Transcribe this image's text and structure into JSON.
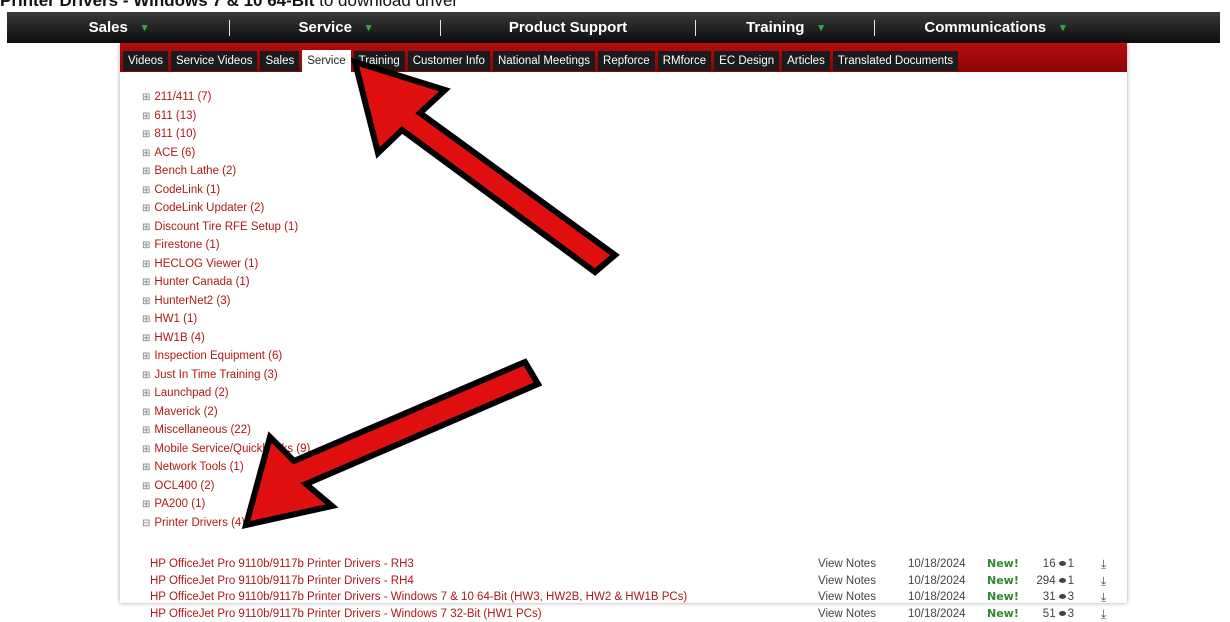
{
  "caption": {
    "prefix": "Printer Drivers - Windows 7 & 10 64-Bit",
    "suffix": " to download driver"
  },
  "navbar": {
    "items": [
      {
        "label": "Sales",
        "caret": true
      },
      {
        "label": "Service",
        "caret": true
      },
      {
        "label": "Product Support",
        "caret": false
      },
      {
        "label": "Training",
        "caret": true
      },
      {
        "label": "Communications",
        "caret": true
      }
    ]
  },
  "subnav": {
    "tabs": [
      "Videos",
      "Service Videos",
      "Sales",
      "Service",
      "Training",
      "Customer Info",
      "National Meetings",
      "Repforce",
      "RMforce",
      "EC Design",
      "Articles",
      "Translated Documents"
    ],
    "active": "Service"
  },
  "tree": [
    {
      "label": "211/411 (7)",
      "expanded": false
    },
    {
      "label": "611 (13)",
      "expanded": false
    },
    {
      "label": "811 (10)",
      "expanded": false
    },
    {
      "label": "ACE (6)",
      "expanded": false
    },
    {
      "label": "Bench Lathe (2)",
      "expanded": false
    },
    {
      "label": "CodeLink (1)",
      "expanded": false
    },
    {
      "label": "CodeLink Updater (2)",
      "expanded": false
    },
    {
      "label": "Discount Tire RFE Setup (1)",
      "expanded": false
    },
    {
      "label": "Firestone (1)",
      "expanded": false
    },
    {
      "label": "HECLOG Viewer (1)",
      "expanded": false
    },
    {
      "label": "Hunter Canada (1)",
      "expanded": false
    },
    {
      "label": "HunterNet2 (3)",
      "expanded": false
    },
    {
      "label": "HW1 (1)",
      "expanded": false
    },
    {
      "label": "HW1B (4)",
      "expanded": false
    },
    {
      "label": "Inspection Equipment (6)",
      "expanded": false
    },
    {
      "label": "Just In Time Training (3)",
      "expanded": false
    },
    {
      "label": "Launchpad (2)",
      "expanded": false
    },
    {
      "label": "Maverick (2)",
      "expanded": false
    },
    {
      "label": "Miscellaneous (22)",
      "expanded": false
    },
    {
      "label": "Mobile Service/Quickbooks (9)",
      "expanded": false
    },
    {
      "label": "Network Tools (1)",
      "expanded": false
    },
    {
      "label": "OCL400 (2)",
      "expanded": false
    },
    {
      "label": "PA200 (1)",
      "expanded": false
    },
    {
      "label": "Printer Drivers (4)",
      "expanded": true
    }
  ],
  "documents": [
    {
      "title": "HP OfficeJet Pro 9110b/9117b Printer Drivers - RH3",
      "notes": "View Notes",
      "date": "10/18/2024",
      "badge": "New!",
      "views": "16",
      "downloads": "1"
    },
    {
      "title": "HP OfficeJet Pro 9110b/9117b Printer Drivers - RH4",
      "notes": "View Notes",
      "date": "10/18/2024",
      "badge": "New!",
      "views": "294",
      "downloads": "1"
    },
    {
      "title": "HP OfficeJet Pro 9110b/9117b Printer Drivers - Windows 7 & 10 64-Bit (HW3, HW2B, HW2 & HW1B PCs)",
      "notes": "View Notes",
      "date": "10/18/2024",
      "badge": "New!",
      "views": "31",
      "downloads": "3"
    },
    {
      "title": "HP OfficeJet Pro 9110b/9117b Printer Drivers - Windows 7 32-Bit (HW1 PCs)",
      "notes": "View Notes",
      "date": "10/18/2024",
      "badge": "New!",
      "views": "51",
      "downloads": "3"
    }
  ],
  "icons": {
    "collapsed": "plus-box-icon",
    "expanded": "minus-box-icon",
    "views": "eye-icon",
    "download": "download-icon"
  },
  "colors": {
    "link": "#b01818",
    "new_badge": "#2d8a2d",
    "subnav_bg": "#a00909",
    "arrow_fill": "#e01010"
  }
}
